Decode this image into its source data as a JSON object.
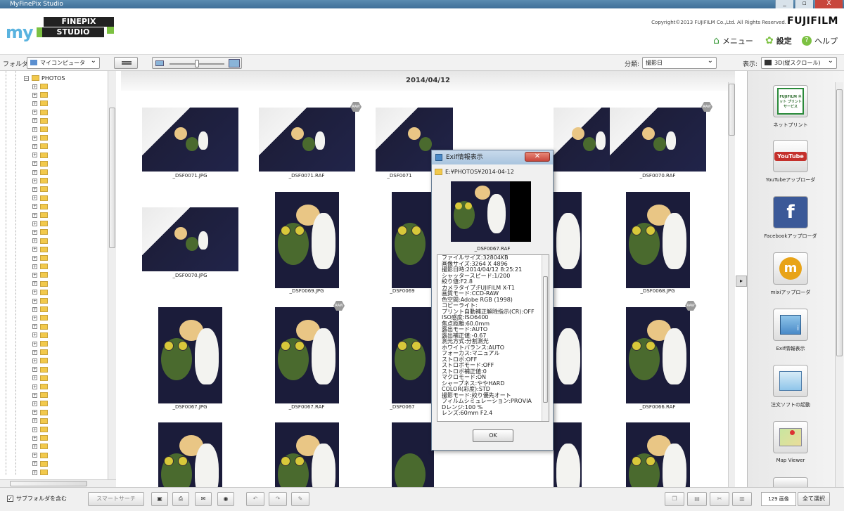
{
  "window": {
    "title": "MyFinePix Studio",
    "controls": [
      "_",
      "▫",
      "X"
    ]
  },
  "header": {
    "logo_my": "my",
    "logo_line1": "FINEPIX",
    "logo_line2": "STUDIO",
    "copyright": "Copyright©2013 FUJIFILM Co.,Ltd. All Rights Reserved.",
    "brand": "FUJIFILM",
    "nav": {
      "menu_label": "メニュー",
      "settings_label": "設定",
      "help_label": "ヘルプ"
    }
  },
  "toolbar": {
    "folder_label": "フォルダ:",
    "folder_value": "マイコンピュータ",
    "sort_label": "分類:",
    "sort_value": "撮影日",
    "view_label": "表示:",
    "view_value": "3D(縦スクロール)"
  },
  "tree": {
    "root_label": "PHOTOS"
  },
  "gallery": {
    "date": "2014/04/12",
    "raw_badge": "RAW",
    "items": [
      {
        "name": "_DSF0071.JPG",
        "raw": false
      },
      {
        "name": "_DSF0071.RAF",
        "raw": true
      },
      {
        "name": "_DSF0070.JPG",
        "raw": false
      },
      {
        "name": "_DSF0070.RAF",
        "raw": true
      },
      {
        "name": "_DSF0069.JPG",
        "raw": false
      },
      {
        "name": "_DSF0068.JPG",
        "raw": false
      },
      {
        "name": "_DSF0067.JPG",
        "raw": false
      },
      {
        "name": "_DSF0067.RAF",
        "raw": true
      },
      {
        "name": "_DSF0066.RAF",
        "raw": true
      }
    ],
    "partial_labels": [
      "_DSF0071",
      "G",
      "_DSF0069",
      "G",
      "_DSF0067",
      "G"
    ]
  },
  "right_panel": {
    "items": [
      {
        "label": "ネットプリント",
        "icon_text": "FUJIFILM ネット プリント サービス"
      },
      {
        "label": "YouTubeアップローダ",
        "icon_text": "YouTube"
      },
      {
        "label": "Facebookアップローダ",
        "icon_text": "f"
      },
      {
        "label": "mixiアップローダ",
        "icon_text": "m"
      },
      {
        "label": "Exif情報表示",
        "icon_text": "i"
      },
      {
        "label": "注文ソフトの起動",
        "icon_text": ""
      },
      {
        "label": "Map Viewer",
        "icon_text": ""
      }
    ]
  },
  "statusbar": {
    "subfolder_label": "サブフォルダを含む",
    "smart_search_label": "スマートサーチ",
    "count": "129 画像",
    "select_all": "全て選択"
  },
  "dialog": {
    "title": "Exif情報表示",
    "path": "E:¥PHOTOS¥2014-04-12",
    "filename": "_DSF0067.RAF",
    "ok_label": "OK",
    "rows": [
      "ファイルサイズ:32804KB",
      "画像サイズ:3264 X 4896",
      "撮影日時:2014/04/12 8:25:21",
      "シャッタースピード:1/200",
      "絞り値:F2.8",
      "カメラタイプ:FUJIFILM X-T1",
      "画質モード:CCD-RAW",
      "色空間:Adobe RGB (1998)",
      "コピーライト:",
      "プリント自動補正解除指示(CR):OFF",
      "ISO感度:ISO6400",
      "焦点距離:60.0mm",
      "露出モード:AUTO",
      "露出補正値:-0.67",
      "測光方式:分割測光",
      "ホワイトバランス:AUTO",
      "フォーカス:マニュアル",
      "ストロボ:OFF",
      "ストロボモード:OFF",
      "ストロボ補正値:0",
      "マクロモード:ON",
      "シャープネス:ややHARD",
      "COLOR(彩度):STD",
      "撮影モード:絞り優先オート",
      "フィルムシミュレーション:PROVIA",
      "Dレンジ:100 %",
      "レンズ:60mm F2.4"
    ]
  },
  "colors": {
    "accent_green": "#7cc142",
    "accent_blue": "#5ab3df",
    "titlebar": "#3f6f98"
  }
}
